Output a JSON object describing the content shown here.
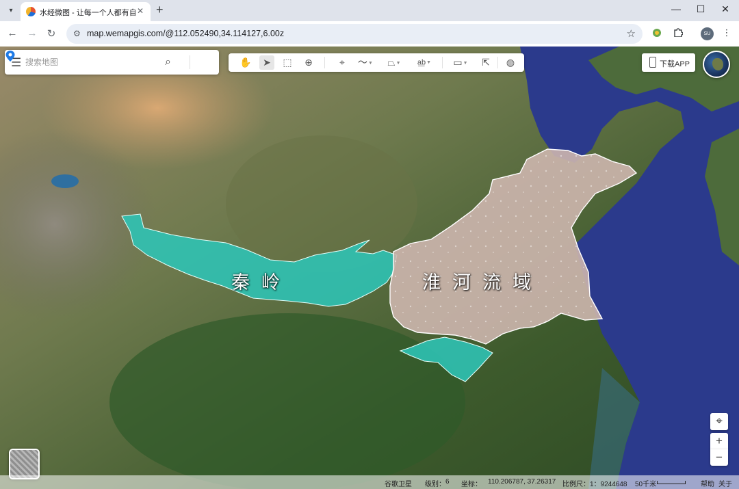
{
  "browser": {
    "tab_title": "水经微图 - 让每一个人都有自己",
    "new_tab": "+",
    "url": "map.wemapgis.com/@112.052490,34.114127,6.00z",
    "profile_initials": "SU",
    "controls": {
      "minimize": "—",
      "maximize": "☐",
      "close": "✕",
      "menu": "⋮",
      "star": "☆",
      "tab_close": "✕",
      "tab_menu": "▾"
    },
    "nav": {
      "back": "←",
      "forward": "→",
      "reload": "↻",
      "site_info": "⚙"
    }
  },
  "map": {
    "search_placeholder": "搜索地图",
    "menu_icon": "☰",
    "search_icon": "⌕",
    "download_label": "下载APP",
    "tools": [
      {
        "name": "pan-tool",
        "glyph": "✋"
      },
      {
        "name": "select-tool",
        "glyph": "➤"
      },
      {
        "name": "box-select-tool",
        "glyph": "⬚"
      },
      {
        "name": "zoom-search-tool",
        "glyph": "⊕"
      },
      {
        "name": "marker-tool",
        "glyph": "⌖"
      },
      {
        "name": "polyline-tool",
        "glyph": "〜"
      },
      {
        "name": "polygon-tool",
        "glyph": "⏢"
      },
      {
        "name": "text-tool",
        "glyph": "a͟b"
      },
      {
        "name": "measure-tool",
        "glyph": "▭"
      },
      {
        "name": "identify-tool",
        "glyph": "⇱"
      },
      {
        "name": "globe-tool",
        "glyph": "◍"
      }
    ],
    "regions": {
      "qinling": "秦岭",
      "huaihe": "淮河流域"
    },
    "zoom": {
      "locate": "⌖",
      "in": "+",
      "out": "−"
    },
    "status": {
      "source": "谷歌卫星",
      "level_label": "级别：",
      "level": "6",
      "coord_label": "坐标：",
      "coords": "110.206787, 37.26317",
      "scale_label": "比例尺：",
      "scale": "1：9244648",
      "scale_bar": "50千米",
      "help": "帮助",
      "about": "关于"
    },
    "colors": {
      "qinling_fill": "#2ec4b6",
      "huaihe_fill": "#cdb6ae",
      "sea": "#2b3a8c",
      "pin": "#1e7ae6"
    }
  }
}
